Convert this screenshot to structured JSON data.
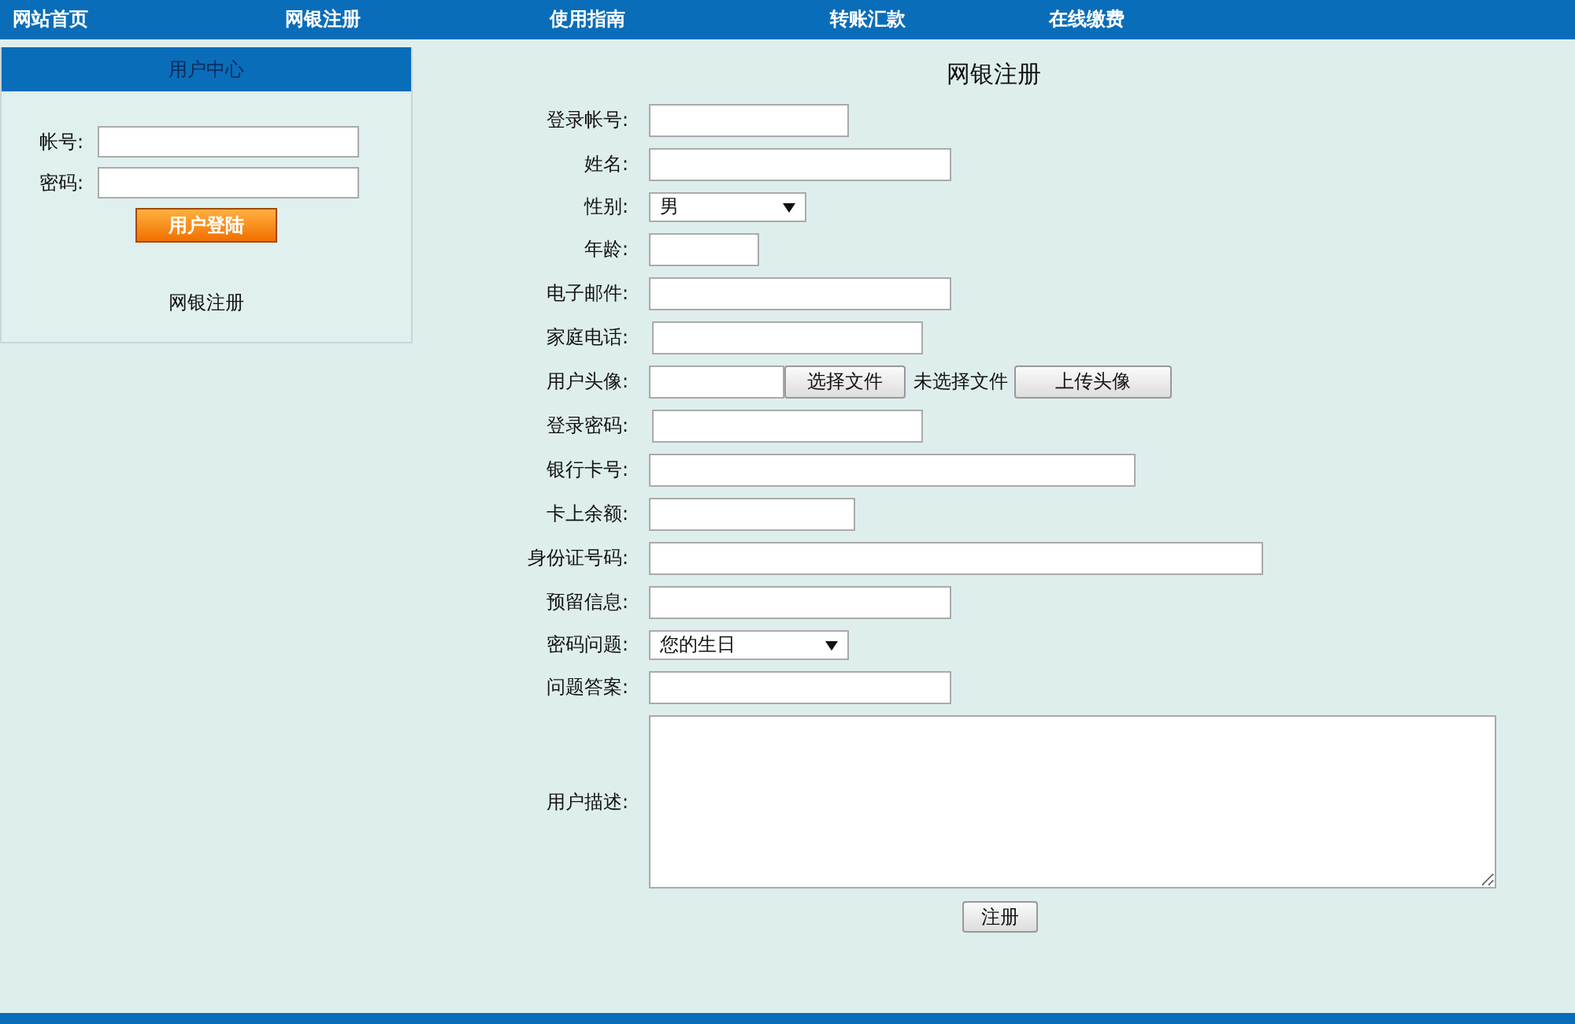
{
  "nav": [
    {
      "label": "网站首页"
    },
    {
      "label": "网银注册"
    },
    {
      "label": "使用指南"
    },
    {
      "label": "转账汇款"
    },
    {
      "label": "在线缴费"
    }
  ],
  "sidebar": {
    "title": "用户中心",
    "fields": [
      {
        "label": "帐号:"
      },
      {
        "label": "密码:"
      }
    ],
    "login_button": "用户登陆",
    "register_link": "网银注册"
  },
  "form": {
    "title": "网银注册",
    "rows": [
      {
        "kind": "text",
        "label": "登录帐号:"
      },
      {
        "kind": "text",
        "label": "姓名:"
      },
      {
        "kind": "select",
        "label": "性别:",
        "value": "男"
      },
      {
        "kind": "text",
        "label": "年龄:"
      },
      {
        "kind": "text",
        "label": "电子邮件:"
      },
      {
        "kind": "text",
        "label": "家庭电话:"
      },
      {
        "kind": "file",
        "label": "用户头像:",
        "choose_button": "选择文件",
        "file_status": "未选择文件",
        "upload_button": "上传头像"
      },
      {
        "kind": "text",
        "label": "登录密码:"
      },
      {
        "kind": "text",
        "label": "银行卡号:"
      },
      {
        "kind": "text",
        "label": "卡上余额:"
      },
      {
        "kind": "text",
        "label": "身份证号码:"
      },
      {
        "kind": "text",
        "label": "预留信息:"
      },
      {
        "kind": "select",
        "label": "密码问题:",
        "value": "您的生日"
      },
      {
        "kind": "text",
        "label": "问题答案:"
      },
      {
        "kind": "textarea",
        "label": "用户描述:"
      }
    ],
    "submit_button": "注册"
  }
}
